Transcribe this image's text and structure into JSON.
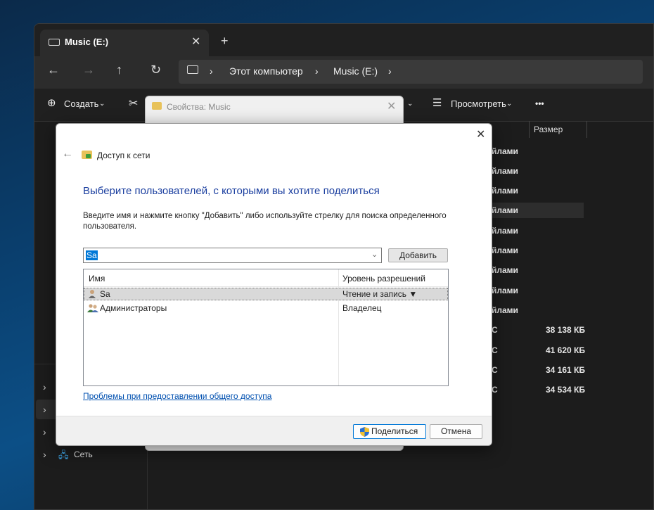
{
  "explorer": {
    "tab_title": "Music (E:)",
    "tab_close": "✕",
    "new_tab": "+",
    "nav": {
      "back": "←",
      "forward": "→",
      "up": "↑",
      "refresh": "↻"
    },
    "breadcrumb": [
      "Этот компьютер",
      "Music (E:)"
    ],
    "breadcrumb_sep": "›",
    "commands": {
      "create": "Создать",
      "view": "Просмотреть",
      "more": "•••"
    },
    "column_size": "Размер",
    "rows_type_suffix": "йлами",
    "file_rows": [
      {
        "type": "С",
        "size": "38 138 КБ"
      },
      {
        "type": "С",
        "size": "41 620 КБ"
      },
      {
        "type": "С",
        "size": "34 161 КБ"
      },
      {
        "type": "С",
        "size": "34 534 КБ"
      }
    ],
    "sidebar_network": "Сеть"
  },
  "properties_window": {
    "title": "Свойства: Music",
    "close": "✕"
  },
  "share_dialog": {
    "close": "✕",
    "back": "←",
    "title": "Доступ к сети",
    "heading": "Выберите пользователей, с которыми вы хотите поделиться",
    "description": "Введите имя и нажмите кнопку \"Добавить\" либо используйте стрелку для поиска определенного пользователя.",
    "input_value": "Sa",
    "add_button": "Добавить",
    "columns": {
      "name": "Имя",
      "permission": "Уровень разрешений"
    },
    "users": [
      {
        "name": "Sa",
        "permission": "Чтение и запись ▼",
        "selected": true
      },
      {
        "name": "Администраторы",
        "permission": "Владелец",
        "selected": false
      }
    ],
    "troubleshoot_link": "Проблемы при предоставлении общего доступа",
    "share_button": "Поделиться",
    "cancel_button": "Отмена"
  }
}
